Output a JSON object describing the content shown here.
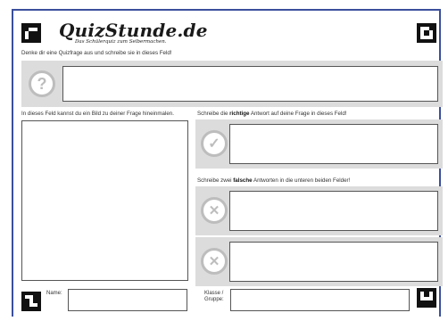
{
  "header": {
    "logo_text": "QuizStunde.de",
    "tagline": "Das Schülerquiz zum Selbermachen."
  },
  "question": {
    "instruction": "Denke dir eine Quizfrage aus und schreibe sie in dieses Feld!",
    "icon_symbol": "?"
  },
  "image_area": {
    "instruction": "In dieses Feld kannst du ein Bild zu deiner Frage hineinmalen."
  },
  "correct": {
    "instruction_pre": "Schreibe die ",
    "instruction_bold": "richtige",
    "instruction_post": " Antwort auf deine Frage in dieses Feld!",
    "icon_symbol": "✓"
  },
  "wrong": {
    "instruction_pre": "Schreibe zwei ",
    "instruction_bold": "falsche",
    "instruction_post": " Antworten in die unteren beiden Felder!",
    "icon_symbol": "✕"
  },
  "footer": {
    "name_label": "Name:",
    "class_label_line1": "Klasse /",
    "class_label_line2": "Gruppe:"
  }
}
